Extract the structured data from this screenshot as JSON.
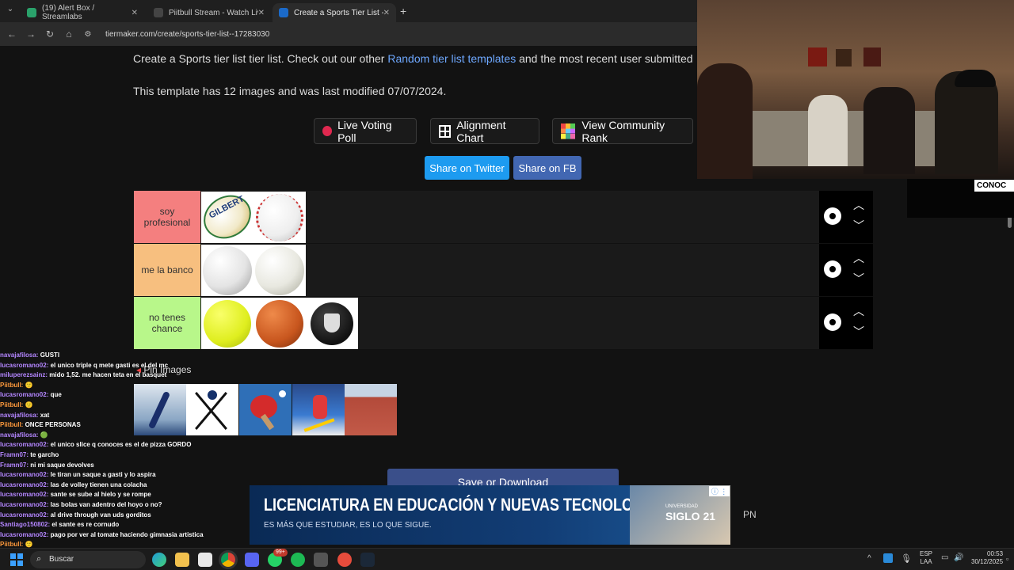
{
  "browser": {
    "tabs": [
      {
        "title": "(19) Alert Box / Streamlabs",
        "color": "#2aa26b"
      },
      {
        "title": "Piitbull Stream - Watch Live",
        "color": "#333333"
      },
      {
        "title": "Create a Sports Tier List - TierM",
        "color": "#1b6ac9"
      }
    ],
    "url": "tiermaker.com/create/sports-tier-list--17283030"
  },
  "page": {
    "intro_prefix": "Create a Sports tier list tier list. Check out our other ",
    "intro_link": "Random tier list templates",
    "intro_suffix": " and the most recent user submitted",
    "template_info": "This template has 12 images and was last modified 07/07/2024.",
    "buttons": {
      "live_voting": "Live Voting Poll",
      "alignment": "Alignment Chart",
      "community": "View Community Rank",
      "twitter": "Share on Twitter",
      "fb": "Share on FB",
      "save": "Save or Download"
    },
    "pin_images": "Pin Images",
    "tiers": [
      {
        "label": "soy profesional",
        "color": "#f47f7f"
      },
      {
        "label": "me la banco",
        "color": "#f7bf7f"
      },
      {
        "label": "no tenes chance",
        "color": "#b8f78a"
      }
    ],
    "ball_text": "GILBERT"
  },
  "overlay": {
    "cam_badge": "CONOC",
    "chat": [
      {
        "u": "navajafilosa:",
        "m": "GUSTI"
      },
      {
        "u": "lucasromano02:",
        "m": "el unico triple q mete gasti es el del mc"
      },
      {
        "u": "miluperezsainz:",
        "m": "mido 1,52. me hacen teta en el basquet"
      },
      {
        "u": "Piitbull:",
        "m": "🙂"
      },
      {
        "u": "lucasromano02:",
        "m": "que"
      },
      {
        "u": "Piitbull:",
        "m": "🙂"
      },
      {
        "u": "navajafilosa:",
        "m": "xat"
      },
      {
        "u": "Piitbull:",
        "m": "ONCE PERSONAS"
      },
      {
        "u": "navajafilosa:",
        "m": "🟢"
      },
      {
        "u": "lucasromano02:",
        "m": "el unico slice q conoces es el de pizza GORDO"
      },
      {
        "u": "Framn07:",
        "m": "te garcho"
      },
      {
        "u": "Framn07:",
        "m": "ni mi saque devolves"
      },
      {
        "u": "lucasromano02:",
        "m": "le tiran un saque a gasti y lo aspira"
      },
      {
        "u": "lucasromano02:",
        "m": "las de volley tienen una colacha"
      },
      {
        "u": "lucasromano02:",
        "m": "sante se sube al hielo y se rompe"
      },
      {
        "u": "lucasromano02:",
        "m": "las bolas van adentro del hoyo o no?"
      },
      {
        "u": "lucasromano02:",
        "m": "al drive through van uds gorditos"
      },
      {
        "u": "Santiago150802:",
        "m": "el sante es re cornudo"
      },
      {
        "u": "lucasromano02:",
        "m": "pago por ver al tomate haciendo gimnasia artistica"
      },
      {
        "u": "Piitbull:",
        "m": "🙂"
      }
    ],
    "ad_headline": "LICENCIATURA EN EDUCACIÓN Y NUEVAS TECNOLOGÍAS",
    "ad_sub": "ES MÁS QUE ESTUDIAR, ES LO QUE SIGUE.",
    "ad_brand_small": "UNIVERSIDAD",
    "ad_brand": "SIGLO 21",
    "ad_side": "PN"
  },
  "taskbar": {
    "search": "Buscar",
    "badge": "99+",
    "lang1": "ESP",
    "lang2": "LAA",
    "time": "00:53",
    "date": "30/12/2025"
  }
}
